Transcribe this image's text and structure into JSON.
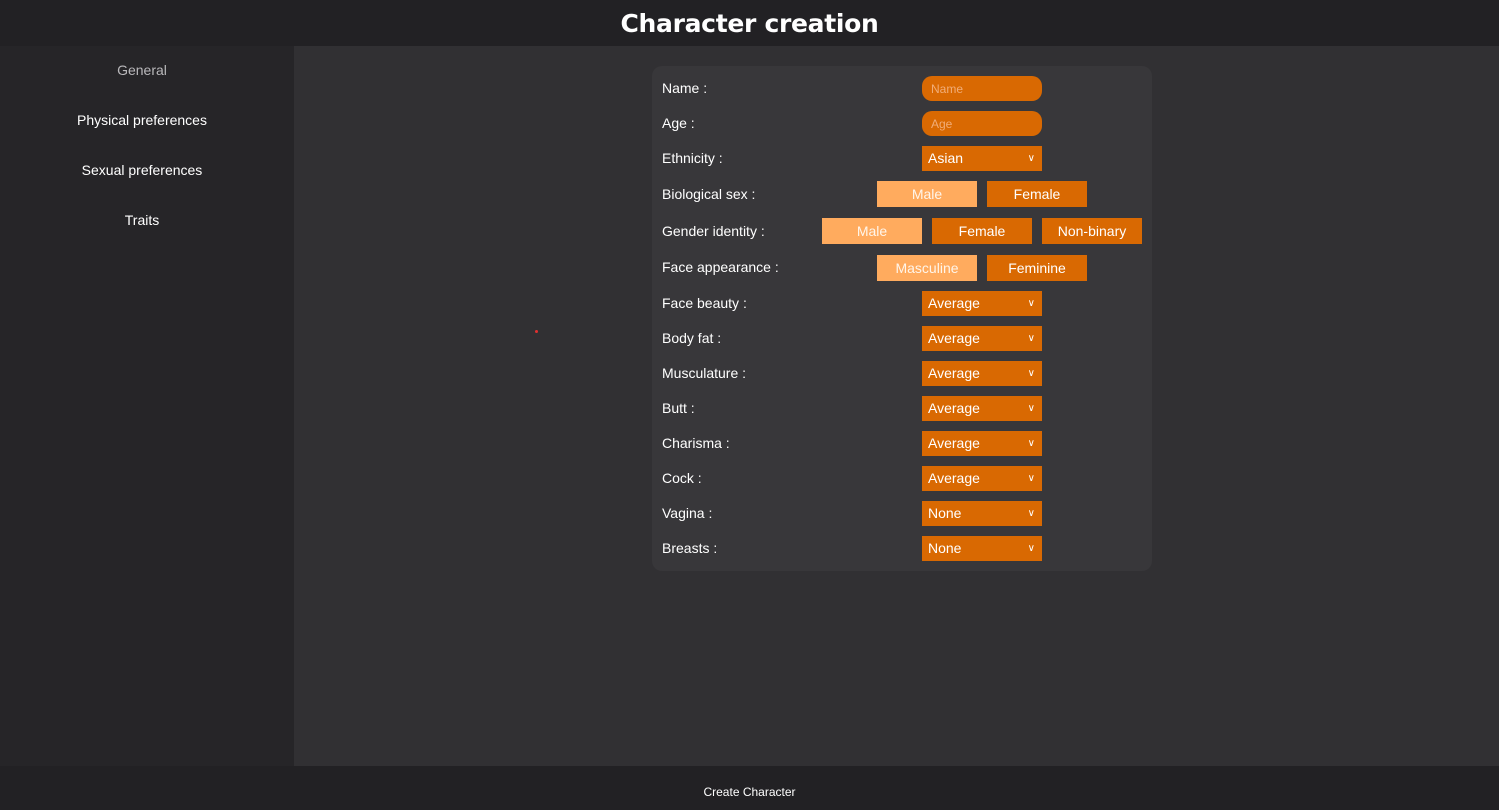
{
  "title": "Character creation",
  "sidebar": {
    "items": [
      {
        "label": "General"
      },
      {
        "label": "Physical preferences"
      },
      {
        "label": "Sexual preferences"
      },
      {
        "label": "Traits"
      }
    ]
  },
  "form": {
    "name": {
      "label": "Name :",
      "placeholder": "Name"
    },
    "age": {
      "label": "Age :",
      "placeholder": "Age"
    },
    "ethnicity": {
      "label": "Ethnicity :",
      "value": "Asian"
    },
    "biological_sex": {
      "label": "Biological sex :",
      "options": [
        "Male",
        "Female"
      ],
      "selected": "Male"
    },
    "gender_identity": {
      "label": "Gender identity :",
      "options": [
        "Male",
        "Female",
        "Non-binary"
      ],
      "selected": "Male"
    },
    "face_appearance": {
      "label": "Face appearance :",
      "options": [
        "Masculine",
        "Feminine"
      ],
      "selected": "Masculine"
    },
    "face_beauty": {
      "label": "Face beauty :",
      "value": "Average"
    },
    "body_fat": {
      "label": "Body fat :",
      "value": "Average"
    },
    "musculature": {
      "label": "Musculature :",
      "value": "Average"
    },
    "butt": {
      "label": "Butt :",
      "value": "Average"
    },
    "charisma": {
      "label": "Charisma :",
      "value": "Average"
    },
    "cock": {
      "label": "Cock :",
      "value": "Average"
    },
    "vagina": {
      "label": "Vagina :",
      "value": "None"
    },
    "breasts": {
      "label": "Breasts :",
      "value": "None"
    }
  },
  "footer": {
    "create_label": "Create Character"
  },
  "colors": {
    "accent": "#d96902",
    "selected": "#ffab5e",
    "background": "#313033",
    "bar": "#222124"
  }
}
